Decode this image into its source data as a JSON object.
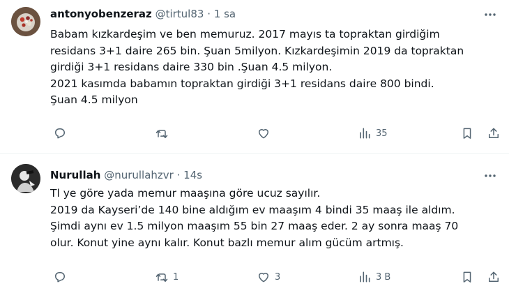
{
  "tweets": [
    {
      "author_name": "antonyobenzeraz",
      "handle": "@tirtul83",
      "separator": "·",
      "time": "1 sa",
      "lines": [
        "Babam kızkardeşim ve ben memuruz. 2017 mayıs ta topraktan girdiğim",
        "residans 3+1 daire 265 bin. Şuan 5milyon. Kızkardeşimin 2019 da topraktan",
        "girdiği 3+1 residans daire 330 bin .Şuan 4.5 milyon.",
        "2021 kasımda babamın topraktan girdiği 3+1 residans daire 800 bindi.",
        "Şuan 4.5 milyon"
      ],
      "actions": {
        "reply_count": "",
        "retweet_count": "",
        "like_count": "",
        "views_count": "35"
      }
    },
    {
      "author_name": "Nurullah",
      "handle": "@nurullahzvr",
      "separator": "·",
      "time": "14s",
      "lines": [
        "Tl ye göre yada memur maaşına göre ucuz sayılır.",
        "2019 da Kayseri’de 140 bine aldığım ev maaşım 4 bindi 35 maaş ile aldım.",
        "Şimdi aynı ev 1.5 milyon maaşım 55 bin 27 maaş eder. 2 ay sonra maaş 70",
        "olur. Konut yine aynı kalır. Konut bazlı memur alım gücüm artmış."
      ],
      "actions": {
        "reply_count": "",
        "retweet_count": "1",
        "like_count": "3",
        "views_count": "3 B"
      }
    }
  ],
  "icons": {
    "reply": "reply-icon",
    "retweet": "retweet-icon",
    "like": "heart-icon",
    "views": "views-icon",
    "bookmark": "bookmark-icon",
    "share": "share-icon",
    "more": "more-icon"
  },
  "colors": {
    "text": "#0f1419",
    "secondary": "#536471",
    "divider": "#eff3f4",
    "background": "#ffffff"
  }
}
